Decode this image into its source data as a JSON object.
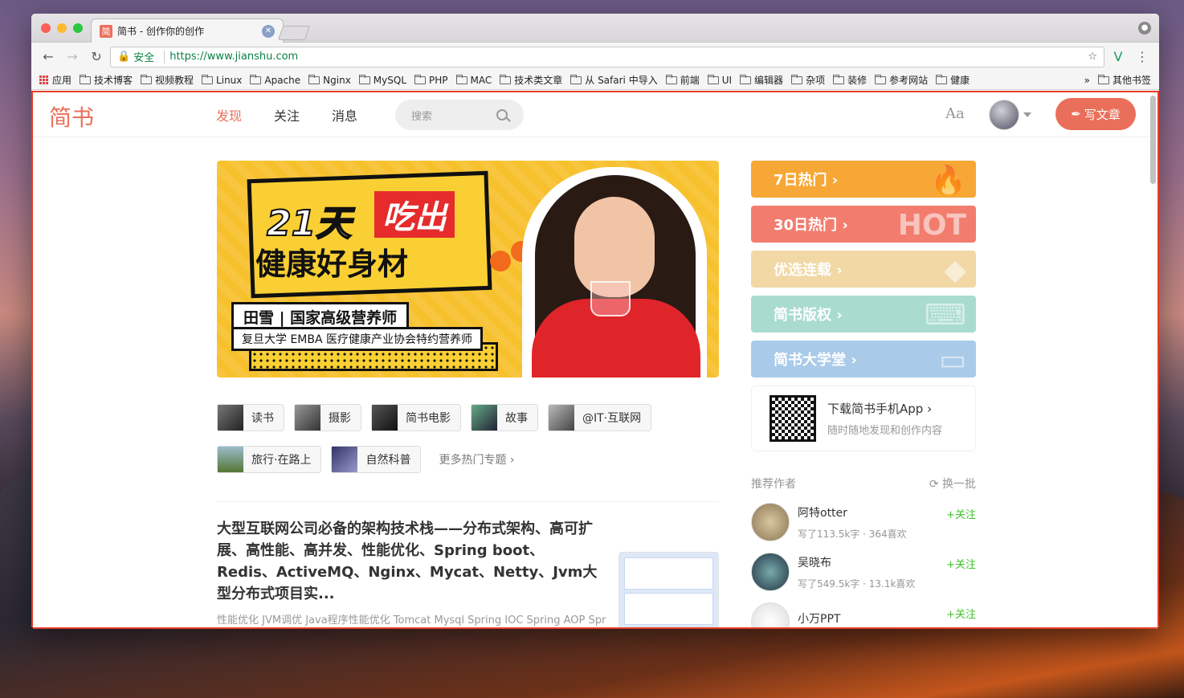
{
  "browser": {
    "tab_title": "简书 - 创作你的创作",
    "favicon": "简",
    "url": "https://www.jianshu.com",
    "secure_label": "安全"
  },
  "bookmarks": {
    "apps": "应用",
    "items": [
      "技术博客",
      "视频教程",
      "Linux",
      "Apache",
      "Nginx",
      "MySQL",
      "PHP",
      "MAC",
      "技术类文章",
      "从 Safari 中导入",
      "前端",
      "UI",
      "编辑器",
      "杂项",
      "装修",
      "参考网站",
      "健康"
    ],
    "overflow": "»",
    "other": "其他书签"
  },
  "header": {
    "logo": "简书",
    "nav": [
      "发现",
      "关注",
      "消息"
    ],
    "search_placeholder": "搜索",
    "aa": "Aa",
    "write": "写文章"
  },
  "banner": {
    "title1": "21天",
    "title_red": "吃出",
    "title2": "健康好身材",
    "name": "田雪 | 国家高级营养师",
    "desc": "复旦大学 EMBA 医疗健康产业协会特约营养师"
  },
  "topics": {
    "row1": [
      "读书",
      "摄影",
      "简书电影",
      "故事",
      "@IT·互联网"
    ],
    "row2": [
      "旅行·在路上",
      "自然科普"
    ],
    "more": "更多热门专题 ›"
  },
  "article": {
    "title": "大型互联网公司必备的架构技术栈——分布式架构、高可扩展、高性能、高并发、性能优化、Spring boot、Redis、ActiveMQ、Nginx、Mycat、Netty、Jvm大型分布式项目实...",
    "abstract": "性能优化 JVM调优 Java程序性能优化 Tomcat Mysql Spring IOC Spring AOP Spring"
  },
  "boards": [
    {
      "label": "7日热门 ›",
      "color": "#f7a735",
      "icon": "flame-icon"
    },
    {
      "label": "30日热门 ›",
      "color": "#f27d6e",
      "icon": "hot-icon"
    },
    {
      "label": "优选连载 ›",
      "color": "#f1d8a5",
      "icon": "diamond-icon"
    },
    {
      "label": "简书版权 ›",
      "color": "#a9dccf",
      "icon": "typewriter-icon"
    },
    {
      "label": "简书大学堂 ›",
      "color": "#a9cbe9",
      "icon": "screen-icon"
    }
  ],
  "app": {
    "title": "下载简书手机App ›",
    "sub": "随时随地发现和创作内容"
  },
  "recommend": {
    "title": "推荐作者",
    "refresh": "换一批",
    "authors": [
      {
        "name": "阿特otter",
        "meta": "写了113.5k字 · 364喜欢",
        "follow": "+关注"
      },
      {
        "name": "吴晓布",
        "meta": "写了549.5k字 · 13.1k喜欢",
        "follow": "+关注"
      },
      {
        "name": "小万PPT",
        "meta": "",
        "follow": "+关注"
      }
    ]
  }
}
